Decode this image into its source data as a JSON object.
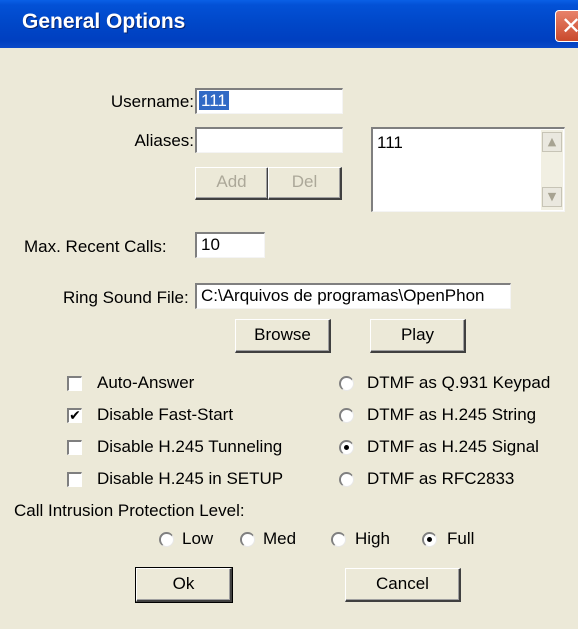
{
  "window": {
    "title": "General Options",
    "close_glyph": "✕"
  },
  "username": {
    "label": "Username:",
    "value": "111"
  },
  "aliases": {
    "label": "Aliases:",
    "value": "",
    "add_label": "Add",
    "del_label": "Del",
    "list_items": [
      "111"
    ]
  },
  "max_recent": {
    "label": "Max. Recent Calls:",
    "value": "10"
  },
  "ring": {
    "label": "Ring Sound File:",
    "value": "C:\\Arquivos de programas\\OpenPhon"
  },
  "buttons": {
    "browse": "Browse",
    "play": "Play",
    "ok": "Ok",
    "cancel": "Cancel"
  },
  "checkboxes": [
    {
      "label": "Auto-Answer",
      "checked": false
    },
    {
      "label": "Disable Fast-Start",
      "checked": true
    },
    {
      "label": "Disable H.245 Tunneling",
      "checked": false
    },
    {
      "label": "Disable H.245 in SETUP",
      "checked": false
    }
  ],
  "dtmf": [
    {
      "label": "DTMF as Q.931 Keypad",
      "selected": false
    },
    {
      "label": "DTMF as H.245 String",
      "selected": false
    },
    {
      "label": "DTMF as H.245 Signal",
      "selected": true
    },
    {
      "label": "DTMF as RFC2833",
      "selected": false
    }
  ],
  "intrusion": {
    "label": "Call Intrusion Protection Level:",
    "options": [
      {
        "label": "Low",
        "selected": false
      },
      {
        "label": "Med",
        "selected": false
      },
      {
        "label": "High",
        "selected": false
      },
      {
        "label": "Full",
        "selected": true
      }
    ]
  },
  "icons": {
    "check_mark": "✔",
    "scroll_up": "▲",
    "scroll_down": "▼"
  }
}
